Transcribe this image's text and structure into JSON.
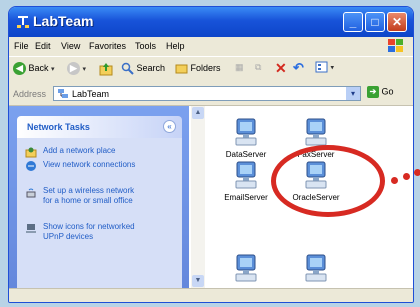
{
  "window": {
    "title": "LabTeam"
  },
  "titlebar_buttons": {
    "minimize": "_",
    "maximize": "□",
    "close": "✕"
  },
  "menu": [
    "File",
    "Edit",
    "View",
    "Favorites",
    "Tools",
    "Help"
  ],
  "toolbar": {
    "back": "Back",
    "search": "Search",
    "folders": "Folders"
  },
  "address": {
    "label": "Address",
    "value": "LabTeam",
    "go": "Go"
  },
  "network_tasks": {
    "title": "Network Tasks",
    "items": [
      "Add a network place",
      "View network connections",
      "Set up a wireless network for a home or small office",
      "Show icons for networked UPnP devices"
    ]
  },
  "computers": [
    "DataServer",
    "FaxServer",
    "EmailServer",
    "OracleServer"
  ],
  "colors": {
    "accent": "#d72a22",
    "title_bar": "#1853d9",
    "task_pane": "#7ba1ef"
  },
  "icons": [
    "network-icon",
    "back-icon",
    "forward-icon",
    "up-folder-icon",
    "search-icon",
    "folders-icon",
    "delete-icon",
    "undo-icon",
    "views-icon",
    "go-icon",
    "computer-icon"
  ]
}
